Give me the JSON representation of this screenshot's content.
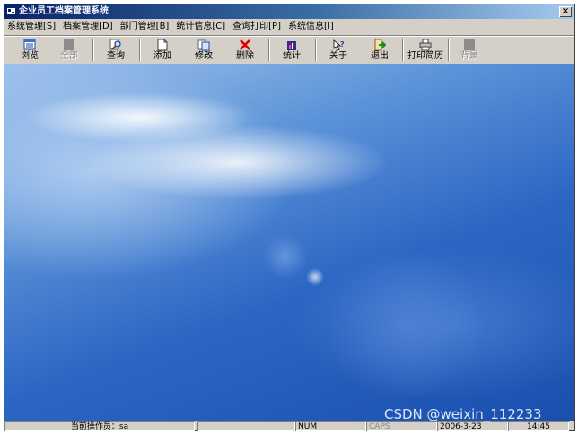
{
  "window": {
    "title": "企业员工档案管理系统",
    "close_label": "×"
  },
  "menu": [
    {
      "label": "系统管理[S]"
    },
    {
      "label": "档案管理[D]"
    },
    {
      "label": "部门管理[B]"
    },
    {
      "label": "统计信息[C]"
    },
    {
      "label": "查询打印[P]"
    },
    {
      "label": "系统信息[I]"
    }
  ],
  "toolbar": {
    "browse": {
      "label": "浏览",
      "icon": "browse-icon"
    },
    "all": {
      "label": "全部",
      "icon": "all-icon",
      "disabled": true
    },
    "search": {
      "label": "查询",
      "icon": "search-icon"
    },
    "add": {
      "label": "添加",
      "icon": "add-icon"
    },
    "edit": {
      "label": "修改",
      "icon": "edit-icon"
    },
    "delete": {
      "label": "删除",
      "icon": "delete-icon"
    },
    "stats": {
      "label": "统计",
      "icon": "stats-icon"
    },
    "about": {
      "label": "关于",
      "icon": "about-icon"
    },
    "exit": {
      "label": "退出",
      "icon": "exit-icon"
    },
    "print": {
      "label": "打印简历",
      "icon": "print-icon"
    },
    "background": {
      "label": "背景",
      "icon": "background-icon",
      "disabled": true
    }
  },
  "statusbar": {
    "operator": "当前操作员：sa",
    "num": "NUM",
    "caps": "CAPS",
    "date": "2006-3-23",
    "time": "14:45"
  },
  "watermark": "CSDN @weixin_112233",
  "colors": {
    "titlebar_start": "#0a246a",
    "face": "#d4d0c8",
    "desktop_blue": "#2c66c4"
  }
}
